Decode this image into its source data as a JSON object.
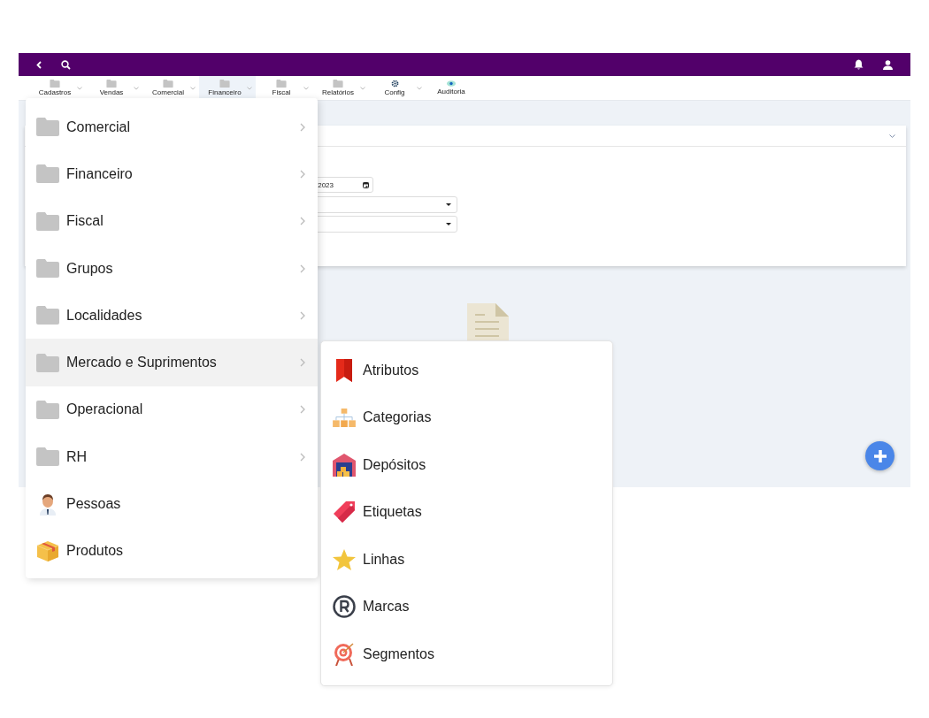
{
  "menubar": [
    {
      "label": "Cadastros",
      "kind": "folder",
      "caret": true,
      "selected": false
    },
    {
      "label": "Vendas",
      "kind": "folder",
      "caret": true,
      "selected": false
    },
    {
      "label": "Comercial",
      "kind": "folder",
      "caret": true,
      "selected": false
    },
    {
      "label": "Financeiro",
      "kind": "folder",
      "caret": true,
      "selected": true
    },
    {
      "label": "Fiscal",
      "kind": "folder",
      "caret": true,
      "selected": false
    },
    {
      "label": "Relatórios",
      "kind": "folder",
      "caret": true,
      "selected": false
    },
    {
      "label": "Config",
      "kind": "gear",
      "caret": true,
      "selected": false
    },
    {
      "label": "Auditoria",
      "kind": "eye",
      "caret": false,
      "selected": false
    }
  ],
  "filter_card": {
    "date_value": "/2023"
  },
  "menu": [
    {
      "label": "Comercial",
      "kind": "folder",
      "selected": false
    },
    {
      "label": "Financeiro",
      "kind": "folder",
      "selected": false
    },
    {
      "label": "Fiscal",
      "kind": "folder",
      "selected": false
    },
    {
      "label": "Grupos",
      "kind": "folder",
      "selected": false
    },
    {
      "label": "Localidades",
      "kind": "folder",
      "selected": false
    },
    {
      "label": "Mercado e Suprimentos",
      "kind": "folder",
      "selected": true
    },
    {
      "label": "Operacional",
      "kind": "folder",
      "selected": false
    },
    {
      "label": "RH",
      "kind": "folder",
      "selected": false
    },
    {
      "label": "Pessoas",
      "kind": "person",
      "selected": false
    },
    {
      "label": "Produtos",
      "kind": "box",
      "selected": false
    }
  ],
  "submenu": [
    {
      "label": "Atributos",
      "kind": "bookmark"
    },
    {
      "label": "Categorias",
      "kind": "hierarchy"
    },
    {
      "label": "Depósitos",
      "kind": "warehouse"
    },
    {
      "label": "Etiquetas",
      "kind": "tag"
    },
    {
      "label": "Linhas",
      "kind": "star"
    },
    {
      "label": "Marcas",
      "kind": "registered"
    },
    {
      "label": "Segmentos",
      "kind": "target"
    }
  ]
}
